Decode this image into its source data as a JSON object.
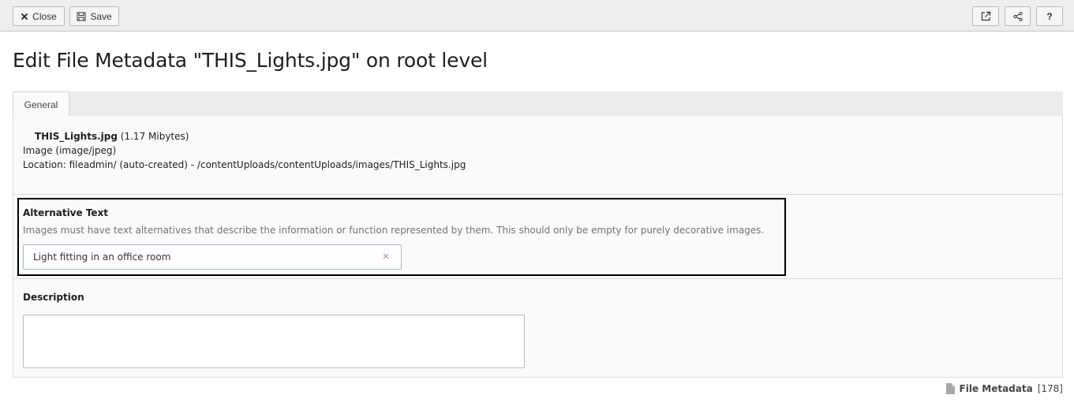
{
  "toolbar": {
    "close_label": "Close",
    "save_label": "Save",
    "open_icon": "external-link-icon",
    "share_icon": "share-icon",
    "help_label": "?"
  },
  "page_title": "Edit File Metadata \"THIS_Lights.jpg\" on root level",
  "tabs": [
    {
      "label": "General"
    }
  ],
  "file": {
    "name": "THIS_Lights.jpg",
    "size": "(1.17 Mibytes)",
    "type": "Image (image/jpeg)",
    "location": "Location: fileadmin/ (auto-created) - /contentUploads/contentUploads/images/THIS_Lights.jpg"
  },
  "alternative": {
    "label": "Alternative Text",
    "description": "Images must have text alternatives that describe the information or function represented by them. This should only be empty for purely decorative images.",
    "value": "Light fitting in an office room"
  },
  "description_field": {
    "label": "Description",
    "value": ""
  },
  "footer": {
    "record_type": "File Metadata",
    "record_id": "[178]"
  },
  "colors": {
    "toolbar_bg": "#eeeeee",
    "panel_bg": "#fafafa",
    "focus_border": "#000000",
    "input_border": "#99b7d6"
  }
}
